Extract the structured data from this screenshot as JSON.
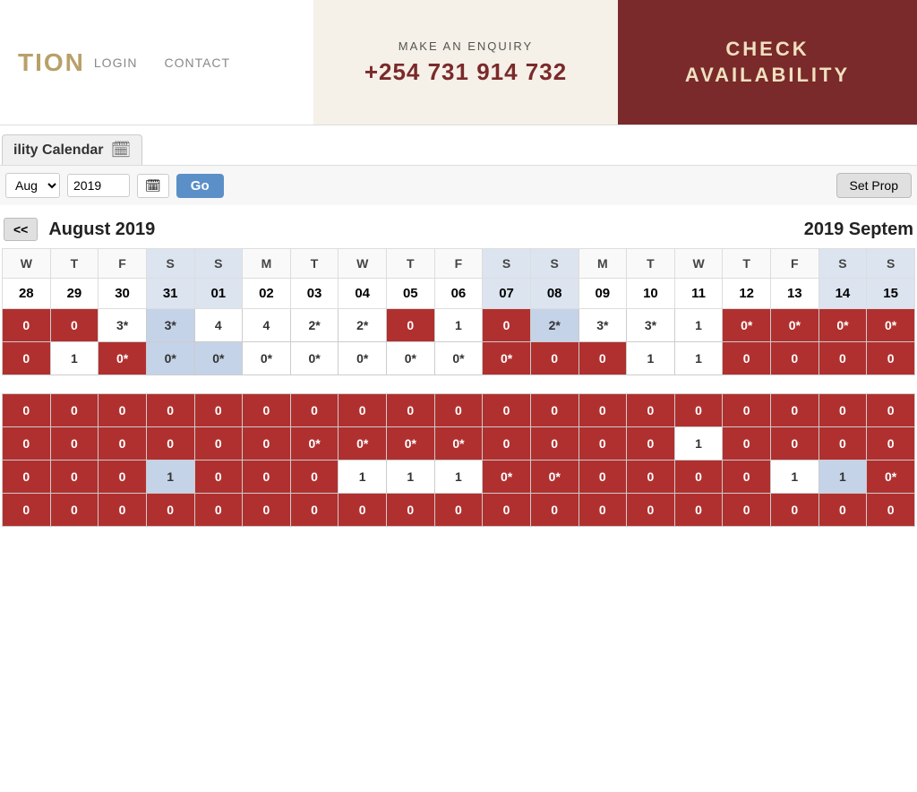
{
  "header": {
    "logo": "TION",
    "nav": [
      {
        "label": "LOGIN"
      },
      {
        "label": "CONTACT"
      }
    ],
    "enquiry": {
      "label": "MAKE AN ENQUIRY",
      "phone": "+254 731 914 732"
    },
    "check": {
      "line1": "CHECK",
      "line2": "AVAILABILITY"
    }
  },
  "calendar": {
    "title": "ility Calendar",
    "icon": "🗓",
    "month_select_value": "Aug",
    "year_value": "2019",
    "go_label": "Go",
    "set_prop_label": "Set Prop",
    "prev_nav": "<<",
    "current_month": "August 2019",
    "next_month": "2019 Septem",
    "day_headers": [
      {
        "label": "W",
        "weekend": false
      },
      {
        "label": "T",
        "weekend": false
      },
      {
        "label": "F",
        "weekend": false
      },
      {
        "label": "S",
        "weekend": true
      },
      {
        "label": "S",
        "weekend": true
      },
      {
        "label": "M",
        "weekend": false
      },
      {
        "label": "T",
        "weekend": false
      },
      {
        "label": "W",
        "weekend": false
      },
      {
        "label": "T",
        "weekend": false
      },
      {
        "label": "F",
        "weekend": false
      },
      {
        "label": "S",
        "weekend": true
      },
      {
        "label": "S",
        "weekend": true
      },
      {
        "label": "M",
        "weekend": false
      },
      {
        "label": "T",
        "weekend": false
      },
      {
        "label": "W",
        "weekend": false
      },
      {
        "label": "T",
        "weekend": false
      },
      {
        "label": "F",
        "weekend": false
      },
      {
        "label": "S",
        "weekend": true
      },
      {
        "label": "S",
        "weekend": true
      }
    ],
    "dates": [
      {
        "val": "28",
        "weekend": false
      },
      {
        "val": "29",
        "weekend": false
      },
      {
        "val": "30",
        "weekend": false
      },
      {
        "val": "31",
        "weekend": true
      },
      {
        "val": "01",
        "weekend": true
      },
      {
        "val": "02",
        "weekend": false
      },
      {
        "val": "03",
        "weekend": false
      },
      {
        "val": "04",
        "weekend": false
      },
      {
        "val": "05",
        "weekend": false
      },
      {
        "val": "06",
        "weekend": false
      },
      {
        "val": "07",
        "weekend": true
      },
      {
        "val": "08",
        "weekend": true
      },
      {
        "val": "09",
        "weekend": false
      },
      {
        "val": "10",
        "weekend": false
      },
      {
        "val": "11",
        "weekend": false
      },
      {
        "val": "12",
        "weekend": false
      },
      {
        "val": "13",
        "weekend": false
      },
      {
        "val": "14",
        "weekend": true
      },
      {
        "val": "15",
        "weekend": true
      }
    ],
    "avail_rows": [
      {
        "cells": [
          {
            "val": "0",
            "type": "red"
          },
          {
            "val": "0",
            "type": "red"
          },
          {
            "val": "3*",
            "type": "white"
          },
          {
            "val": "3*",
            "type": "blue"
          },
          {
            "val": "4",
            "type": "white"
          },
          {
            "val": "4",
            "type": "white"
          },
          {
            "val": "2*",
            "type": "white"
          },
          {
            "val": "2*",
            "type": "white"
          },
          {
            "val": "0",
            "type": "red"
          },
          {
            "val": "1",
            "type": "white"
          },
          {
            "val": "0",
            "type": "red"
          },
          {
            "val": "2*",
            "type": "blue"
          },
          {
            "val": "3*",
            "type": "white"
          },
          {
            "val": "3*",
            "type": "white"
          },
          {
            "val": "1",
            "type": "white"
          },
          {
            "val": "0*",
            "type": "red"
          },
          {
            "val": "0*",
            "type": "red"
          },
          {
            "val": "0*",
            "type": "red"
          },
          {
            "val": "0*",
            "type": "red"
          }
        ]
      },
      {
        "cells": [
          {
            "val": "0",
            "type": "red"
          },
          {
            "val": "1",
            "type": "white"
          },
          {
            "val": "0*",
            "type": "red"
          },
          {
            "val": "0*",
            "type": "blue"
          },
          {
            "val": "0*",
            "type": "blue"
          },
          {
            "val": "0*",
            "type": "white"
          },
          {
            "val": "0*",
            "type": "white"
          },
          {
            "val": "0*",
            "type": "white"
          },
          {
            "val": "0*",
            "type": "white"
          },
          {
            "val": "0*",
            "type": "white"
          },
          {
            "val": "0*",
            "type": "red"
          },
          {
            "val": "0",
            "type": "red"
          },
          {
            "val": "0",
            "type": "red"
          },
          {
            "val": "1",
            "type": "white"
          },
          {
            "val": "1",
            "type": "white"
          },
          {
            "val": "0",
            "type": "red"
          },
          {
            "val": "0",
            "type": "red"
          },
          {
            "val": "0",
            "type": "red"
          },
          {
            "val": "0",
            "type": "red"
          }
        ]
      }
    ],
    "lower_rows": [
      {
        "cells": [
          {
            "val": "0",
            "type": "red"
          },
          {
            "val": "0",
            "type": "red"
          },
          {
            "val": "0",
            "type": "red"
          },
          {
            "val": "0",
            "type": "red"
          },
          {
            "val": "0",
            "type": "red"
          },
          {
            "val": "0",
            "type": "red"
          },
          {
            "val": "0",
            "type": "red"
          },
          {
            "val": "0",
            "type": "red"
          },
          {
            "val": "0",
            "type": "red"
          },
          {
            "val": "0",
            "type": "red"
          },
          {
            "val": "0",
            "type": "red"
          },
          {
            "val": "0",
            "type": "red"
          },
          {
            "val": "0",
            "type": "red"
          },
          {
            "val": "0",
            "type": "red"
          },
          {
            "val": "0",
            "type": "red"
          },
          {
            "val": "0",
            "type": "red"
          },
          {
            "val": "0",
            "type": "red"
          },
          {
            "val": "0",
            "type": "red"
          },
          {
            "val": "0",
            "type": "red"
          }
        ]
      },
      {
        "cells": [
          {
            "val": "0",
            "type": "red"
          },
          {
            "val": "0",
            "type": "red"
          },
          {
            "val": "0",
            "type": "red"
          },
          {
            "val": "0",
            "type": "red"
          },
          {
            "val": "0",
            "type": "red"
          },
          {
            "val": "0",
            "type": "red"
          },
          {
            "val": "0*",
            "type": "red"
          },
          {
            "val": "0*",
            "type": "red"
          },
          {
            "val": "0*",
            "type": "red"
          },
          {
            "val": "0*",
            "type": "red"
          },
          {
            "val": "0",
            "type": "red"
          },
          {
            "val": "0",
            "type": "red"
          },
          {
            "val": "0",
            "type": "red"
          },
          {
            "val": "0",
            "type": "red"
          },
          {
            "val": "1",
            "type": "white"
          },
          {
            "val": "0",
            "type": "red"
          },
          {
            "val": "0",
            "type": "red"
          },
          {
            "val": "0",
            "type": "red"
          },
          {
            "val": "0",
            "type": "red"
          }
        ]
      },
      {
        "cells": [
          {
            "val": "0",
            "type": "red"
          },
          {
            "val": "0",
            "type": "red"
          },
          {
            "val": "0",
            "type": "red"
          },
          {
            "val": "1",
            "type": "blue"
          },
          {
            "val": "0",
            "type": "red"
          },
          {
            "val": "0",
            "type": "red"
          },
          {
            "val": "0",
            "type": "red"
          },
          {
            "val": "1",
            "type": "white"
          },
          {
            "val": "1",
            "type": "white"
          },
          {
            "val": "1",
            "type": "white"
          },
          {
            "val": "0*",
            "type": "red"
          },
          {
            "val": "0*",
            "type": "red"
          },
          {
            "val": "0",
            "type": "red"
          },
          {
            "val": "0",
            "type": "red"
          },
          {
            "val": "0",
            "type": "red"
          },
          {
            "val": "0",
            "type": "red"
          },
          {
            "val": "1",
            "type": "white"
          },
          {
            "val": "1",
            "type": "blue"
          },
          {
            "val": "0*",
            "type": "red"
          }
        ]
      },
      {
        "cells": [
          {
            "val": "0",
            "type": "red"
          },
          {
            "val": "0",
            "type": "red"
          },
          {
            "val": "0",
            "type": "red"
          },
          {
            "val": "0",
            "type": "red"
          },
          {
            "val": "0",
            "type": "red"
          },
          {
            "val": "0",
            "type": "red"
          },
          {
            "val": "0",
            "type": "red"
          },
          {
            "val": "0",
            "type": "red"
          },
          {
            "val": "0",
            "type": "red"
          },
          {
            "val": "0",
            "type": "red"
          },
          {
            "val": "0",
            "type": "red"
          },
          {
            "val": "0",
            "type": "red"
          },
          {
            "val": "0",
            "type": "red"
          },
          {
            "val": "0",
            "type": "red"
          },
          {
            "val": "0",
            "type": "red"
          },
          {
            "val": "0",
            "type": "red"
          },
          {
            "val": "0",
            "type": "red"
          },
          {
            "val": "0",
            "type": "red"
          },
          {
            "val": "0",
            "type": "red"
          }
        ]
      }
    ]
  }
}
